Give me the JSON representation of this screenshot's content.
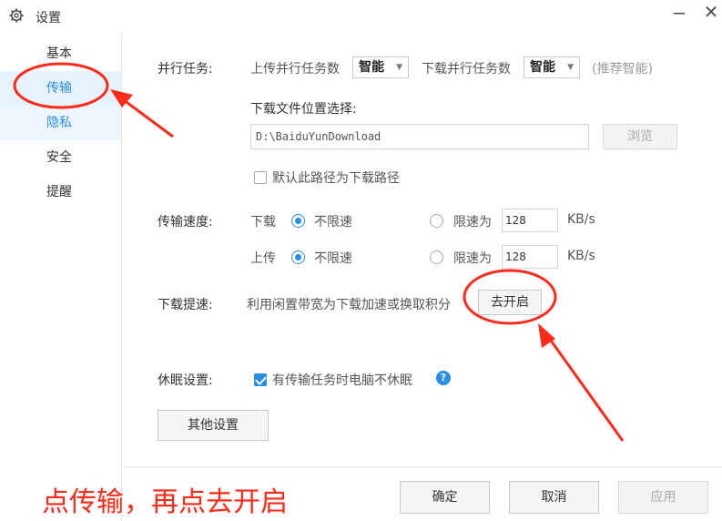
{
  "window": {
    "title": "设置",
    "minimize_glyph": "−",
    "close_glyph": "✕",
    "icons": [
      "gear-icon"
    ]
  },
  "sidebar": {
    "items": [
      {
        "label": "基本"
      },
      {
        "label": "传输"
      },
      {
        "label": "隐私"
      },
      {
        "label": "安全"
      },
      {
        "label": "提醒"
      }
    ]
  },
  "parallel": {
    "label": "并行任务:",
    "upload_label": "上传并行任务数",
    "upload_value": "智能",
    "download_label": "下载并行任务数",
    "download_value": "智能",
    "hint": "(推荐智能)"
  },
  "download_path": {
    "label": "下载文件位置选择:",
    "value": "D:\\BaiduYunDownload",
    "browse_label": "浏览",
    "default_checkbox_label": "默认此路径为下载路径",
    "default_checked": false
  },
  "speed": {
    "label": "传输速度:",
    "download_label": "下载",
    "upload_label": "上传",
    "unlimited_label": "不限速",
    "limit_label": "限速为",
    "download_limit_value": "128",
    "upload_limit_value": "128",
    "unit": "KB/s",
    "download_mode": "unlimited",
    "upload_mode": "unlimited"
  },
  "accelerate": {
    "label": "下载提速:",
    "description": "利用闲置带宽为下载加速或换取积分",
    "button_label": "去开启"
  },
  "sleep": {
    "label": "休眠设置:",
    "checkbox_label": "有传输任务时电脑不休眠",
    "checked": true,
    "help_glyph": "?"
  },
  "other_settings_label": "其他设置",
  "footer": {
    "ok_label": "确定",
    "cancel_label": "取消",
    "apply_label": "应用"
  },
  "annotation": {
    "text": "点传输，再点去开启",
    "color": "#ff2a1a"
  },
  "colors": {
    "accent": "#2a8de6",
    "annotation": "#ff2a1a"
  }
}
